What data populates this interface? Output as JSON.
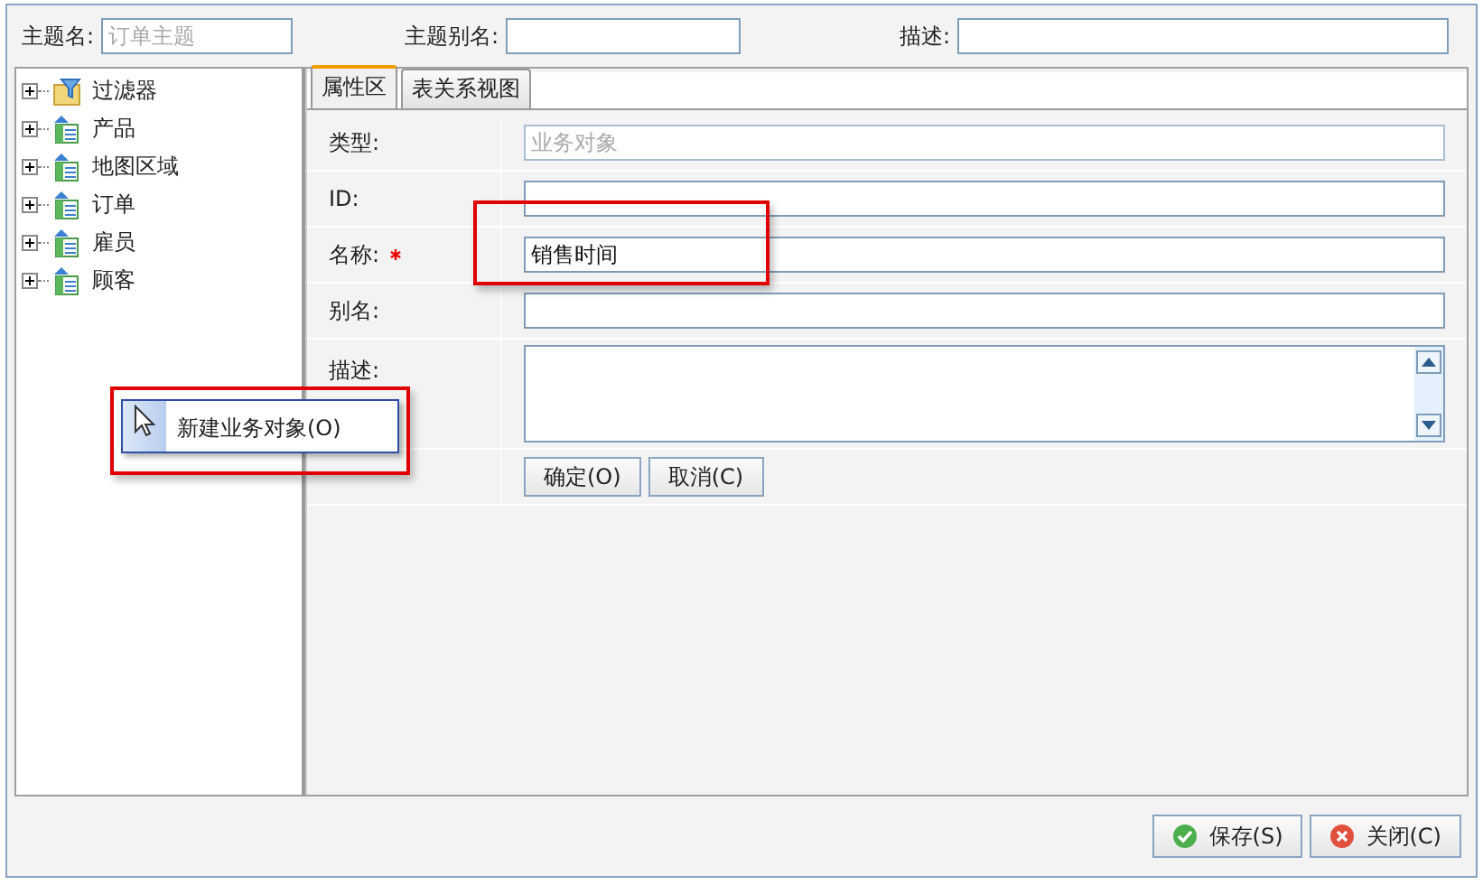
{
  "header": {
    "fields": [
      {
        "label": "主题名:",
        "placeholder": "订单主题"
      },
      {
        "label": "主题别名:"
      },
      {
        "label": "描述:"
      }
    ]
  },
  "tree": {
    "items": [
      {
        "label": "过滤器",
        "kind": "filter",
        "expanded": false
      },
      {
        "label": "产品",
        "kind": "entity",
        "expanded": false
      },
      {
        "label": "地图区域",
        "kind": "entity",
        "expanded": false
      },
      {
        "label": "订单",
        "kind": "entity",
        "expanded": false
      },
      {
        "label": "雇员",
        "kind": "entity",
        "expanded": false
      },
      {
        "label": "顾客",
        "kind": "entity",
        "expanded": false
      }
    ]
  },
  "tabs": [
    {
      "label": "属性区",
      "selected": true
    },
    {
      "label": "表关系视图",
      "selected": false
    }
  ],
  "form": {
    "rows": [
      {
        "label": "类型:",
        "kind": "text",
        "value": "业务对象",
        "disabled": true,
        "required": false
      },
      {
        "label": "ID:",
        "kind": "text",
        "disabled": false,
        "required": false
      },
      {
        "label": "名称:",
        "kind": "text",
        "value": "销售时间",
        "disabled": false,
        "required": true,
        "highlighted": true
      },
      {
        "label": "别名:",
        "kind": "text",
        "disabled": false,
        "required": false
      },
      {
        "label": "描述:",
        "kind": "textarea",
        "required": false
      }
    ],
    "buttons": [
      "确定(O)",
      "取消(C)"
    ]
  },
  "context_menu": {
    "items": [
      {
        "label": "新建业务对象(O)",
        "selected": true
      }
    ],
    "highlighted": true
  },
  "footer": {
    "buttons": [
      {
        "label": "保存(S)",
        "kind": "save"
      },
      {
        "label": "关闭(C)",
        "kind": "close"
      }
    ]
  }
}
